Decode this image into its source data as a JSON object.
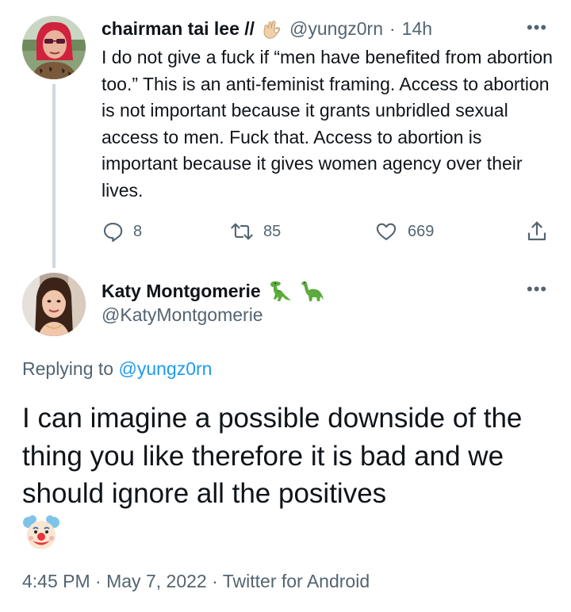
{
  "parent_tweet": {
    "author_name": "chairman tai lee //",
    "author_emoji": "ok-hand-emoji",
    "handle": "@yungz0rn",
    "separator": "·",
    "time_ago": "14h",
    "more_label": "•••",
    "text": "I do not give a fuck if “men have benefited from abortion too.” This is an anti-feminist framing. Access to abortion is not important because it grants unbridled sexual access to men. Fuck that. Access to abortion is important because it gives women agency over their lives.",
    "replies": "8",
    "retweets": "85",
    "likes": "669",
    "icons": [
      "reply-icon",
      "retweet-icon",
      "like-icon",
      "share-icon"
    ]
  },
  "reply_tweet": {
    "author_name": "Katy Montgomerie",
    "author_emojis": [
      "t-rex-emoji",
      "sauropod-emoji"
    ],
    "handle": "@KatyMontgomerie",
    "more_label": "•••",
    "replying_prefix": "Replying to",
    "replying_handle": "@yungz0rn",
    "text": "I can imagine a possible downside of the thing you like therefore it is bad and we should ignore all the positives",
    "trailing_emoji": "clown-face-emoji",
    "time": "4:45 PM",
    "separator": "·",
    "date": "May 7, 2022",
    "source": "Twitter for Android"
  },
  "colors": {
    "text": "#0f1419",
    "secondary": "#536471",
    "link": "#1d9bf0",
    "thread_line": "#cfd9de"
  }
}
